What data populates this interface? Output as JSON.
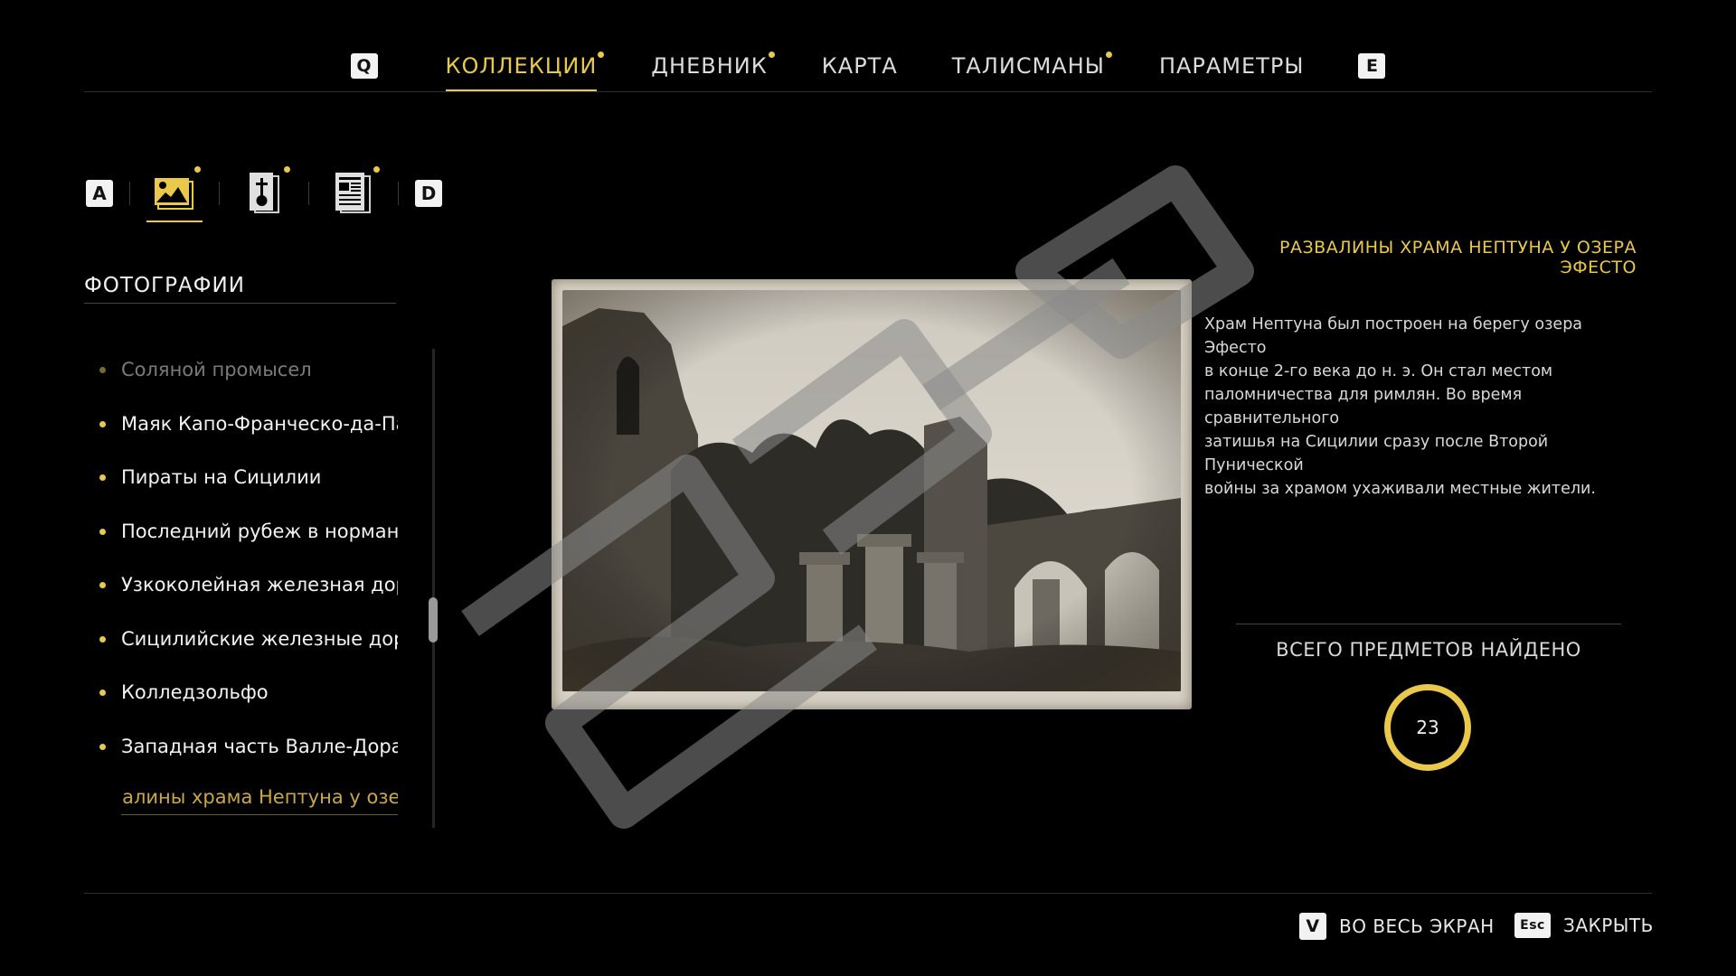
{
  "topnav": {
    "key_left": "Q",
    "key_right": "E",
    "tabs": [
      {
        "label": "КОЛЛЕКЦИИ",
        "active": true,
        "badge": true
      },
      {
        "label": "ДНЕВНИК",
        "active": false,
        "badge": true
      },
      {
        "label": "КАРТА",
        "active": false,
        "badge": false
      },
      {
        "label": "ТАЛИСМАНЫ",
        "active": false,
        "badge": true
      },
      {
        "label": "ПАРАМЕТРЫ",
        "active": false,
        "badge": false
      }
    ]
  },
  "categories": {
    "key_left": "A",
    "key_right": "D",
    "icons": [
      "photo-icon",
      "artifact-icon",
      "document-icon"
    ]
  },
  "section": {
    "title": "ФОТОГРАФИИ"
  },
  "list": {
    "items": [
      {
        "label": "Соляной промысел",
        "state": "faded"
      },
      {
        "label": "Маяк Капо-Франческо-да-Паола",
        "state": "normal"
      },
      {
        "label": "Пираты на Сицилии",
        "state": "normal"
      },
      {
        "label": "Последний рубеж в нормандском замке",
        "state": "normal"
      },
      {
        "label": "Узкоколейная железная дорога",
        "state": "normal"
      },
      {
        "label": "Сицилийские железные дороги",
        "state": "normal"
      },
      {
        "label": "Колледзольфо",
        "state": "normal"
      },
      {
        "label": "Западная часть Валле-Дората",
        "state": "normal"
      },
      {
        "label": "Развалины храма Нептуна у озера Эфесто",
        "state": "selected"
      }
    ]
  },
  "detail": {
    "title": "РАЗВАЛИНЫ ХРАМА НЕПТУНА У ОЗЕРА ЭФЕСТО",
    "lines": [
      "Храм Нептуна был построен на берегу озера Эфесто",
      "в конце 2-го века до н. э. Он стал местом",
      "паломничества для римлян. Во время сравнительного",
      "затишья на Сицилии сразу после Второй Пунической",
      "войны за храмом ухаживали местные жители."
    ]
  },
  "counter": {
    "label": "ВСЕГО ПРЕДМЕТОВ НАЙДЕНО",
    "value": "23"
  },
  "hints": {
    "fullscreen": {
      "key": "V",
      "label": "ВО ВЕСЬ ЭКРАН"
    },
    "close": {
      "key": "Esc",
      "label": "ЗАКРЫТЬ"
    }
  },
  "colors": {
    "accent": "#e9c84a",
    "background": "#000000"
  }
}
